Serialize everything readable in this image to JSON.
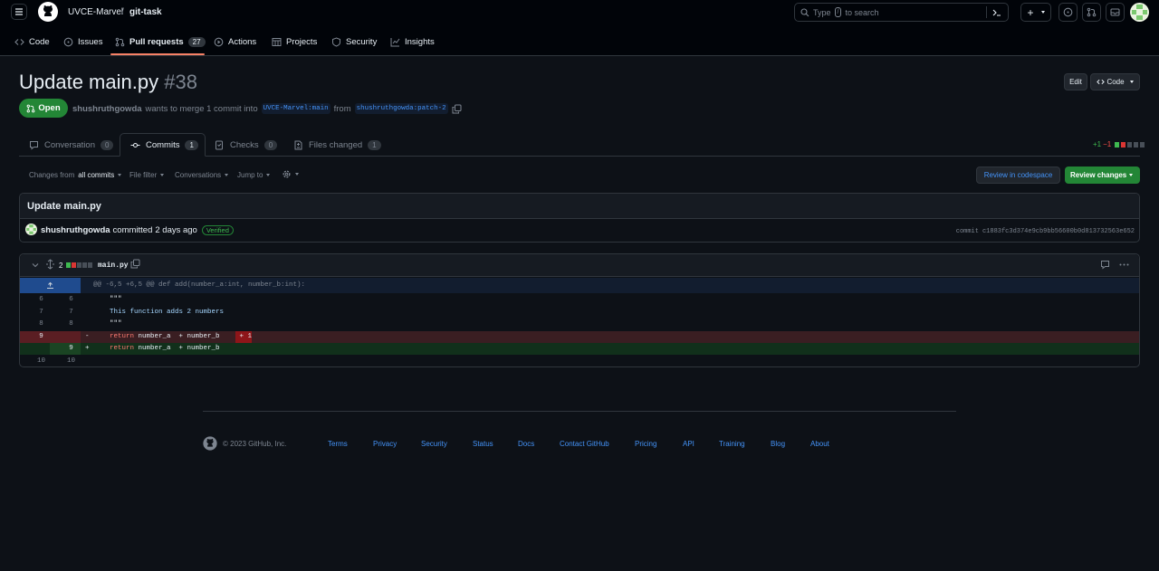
{
  "header": {
    "owner": "UVCE-Marvel",
    "separator": "/",
    "repo": "git-task",
    "search_type": "Type",
    "search_key": "/",
    "search_rest": "to search",
    "plus_label": "+"
  },
  "repo_nav": [
    {
      "label": "Code",
      "icon": "code-icon"
    },
    {
      "label": "Issues",
      "icon": "issue-icon"
    },
    {
      "label": "Pull requests",
      "icon": "pull-request-icon",
      "count": "27"
    },
    {
      "label": "Actions",
      "icon": "play-icon"
    },
    {
      "label": "Projects",
      "icon": "table-icon"
    },
    {
      "label": "Security",
      "icon": "shield-icon"
    },
    {
      "label": "Insights",
      "icon": "graph-icon"
    }
  ],
  "pr": {
    "title": "Update main.py",
    "number": "#38",
    "state": "Open",
    "author": "shushruthgowda",
    "merge_text": "wants to merge 1 commit into",
    "base_branch": "UVCE-Marvel:main",
    "from_text": "from",
    "head_branch": "shushruthgowda:patch-2",
    "edit_label": "Edit",
    "code_label": "Code"
  },
  "tabs": [
    {
      "label": "Conversation",
      "count": "0",
      "icon": "comment-icon"
    },
    {
      "label": "Commits",
      "count": "1",
      "icon": "commit-icon"
    },
    {
      "label": "Checks",
      "count": "0",
      "icon": "checklist-icon"
    },
    {
      "label": "Files changed",
      "count": "1",
      "icon": "file-diff-icon"
    }
  ],
  "diffstat": {
    "additions": "+1",
    "deletions": "−1"
  },
  "toolbar": {
    "changes_from": "Changes from",
    "all_commits": "all commits",
    "file_filter": "File filter",
    "conversations": "Conversations",
    "jump_to": "Jump to",
    "review_codespace": "Review in codespace",
    "review_changes": "Review changes"
  },
  "commit": {
    "message": "Update main.py",
    "author": "shushruthgowda",
    "committed": "committed",
    "time": "2 days ago",
    "verified": "Verified",
    "sha_label": "commit",
    "sha": "c1883fc3d374e9cb9bb56600b0d813732563e652"
  },
  "file": {
    "change_count": "2",
    "name": "main.py",
    "hunk_header": "@@ -6,5 +6,5 @@ def add(number_a:int, number_b:int):",
    "lines": [
      {
        "old": "6",
        "new": "6",
        "sign": "",
        "type": "ctx",
        "code": "\"\"\""
      },
      {
        "old": "7",
        "new": "7",
        "sign": "",
        "type": "ctx",
        "code": "This function adds 2 numbers"
      },
      {
        "old": "8",
        "new": "8",
        "sign": "",
        "type": "ctx",
        "code": "\"\"\""
      },
      {
        "old": "9",
        "new": "",
        "sign": "-",
        "type": "del",
        "keyword": "return",
        "code": " number_a  + number_b",
        "removed": " + 1"
      },
      {
        "old": "",
        "new": "9",
        "sign": "+",
        "type": "add",
        "keyword": "return",
        "code": " number_a  + number_b"
      },
      {
        "old": "10",
        "new": "10",
        "sign": "",
        "type": "ctx",
        "code": ""
      }
    ]
  },
  "footer": {
    "copyright": "© 2023 GitHub, Inc.",
    "links": [
      "Terms",
      "Privacy",
      "Security",
      "Status",
      "Docs",
      "Contact GitHub",
      "Pricing",
      "API",
      "Training",
      "Blog",
      "About"
    ]
  },
  "colors": {
    "background": "#0d1117",
    "accent_green": "#238636",
    "link_blue": "#4493f8",
    "deletion_bg": "#3a1e22",
    "addition_bg": "#11301b",
    "tab_underline": "#f78166"
  }
}
